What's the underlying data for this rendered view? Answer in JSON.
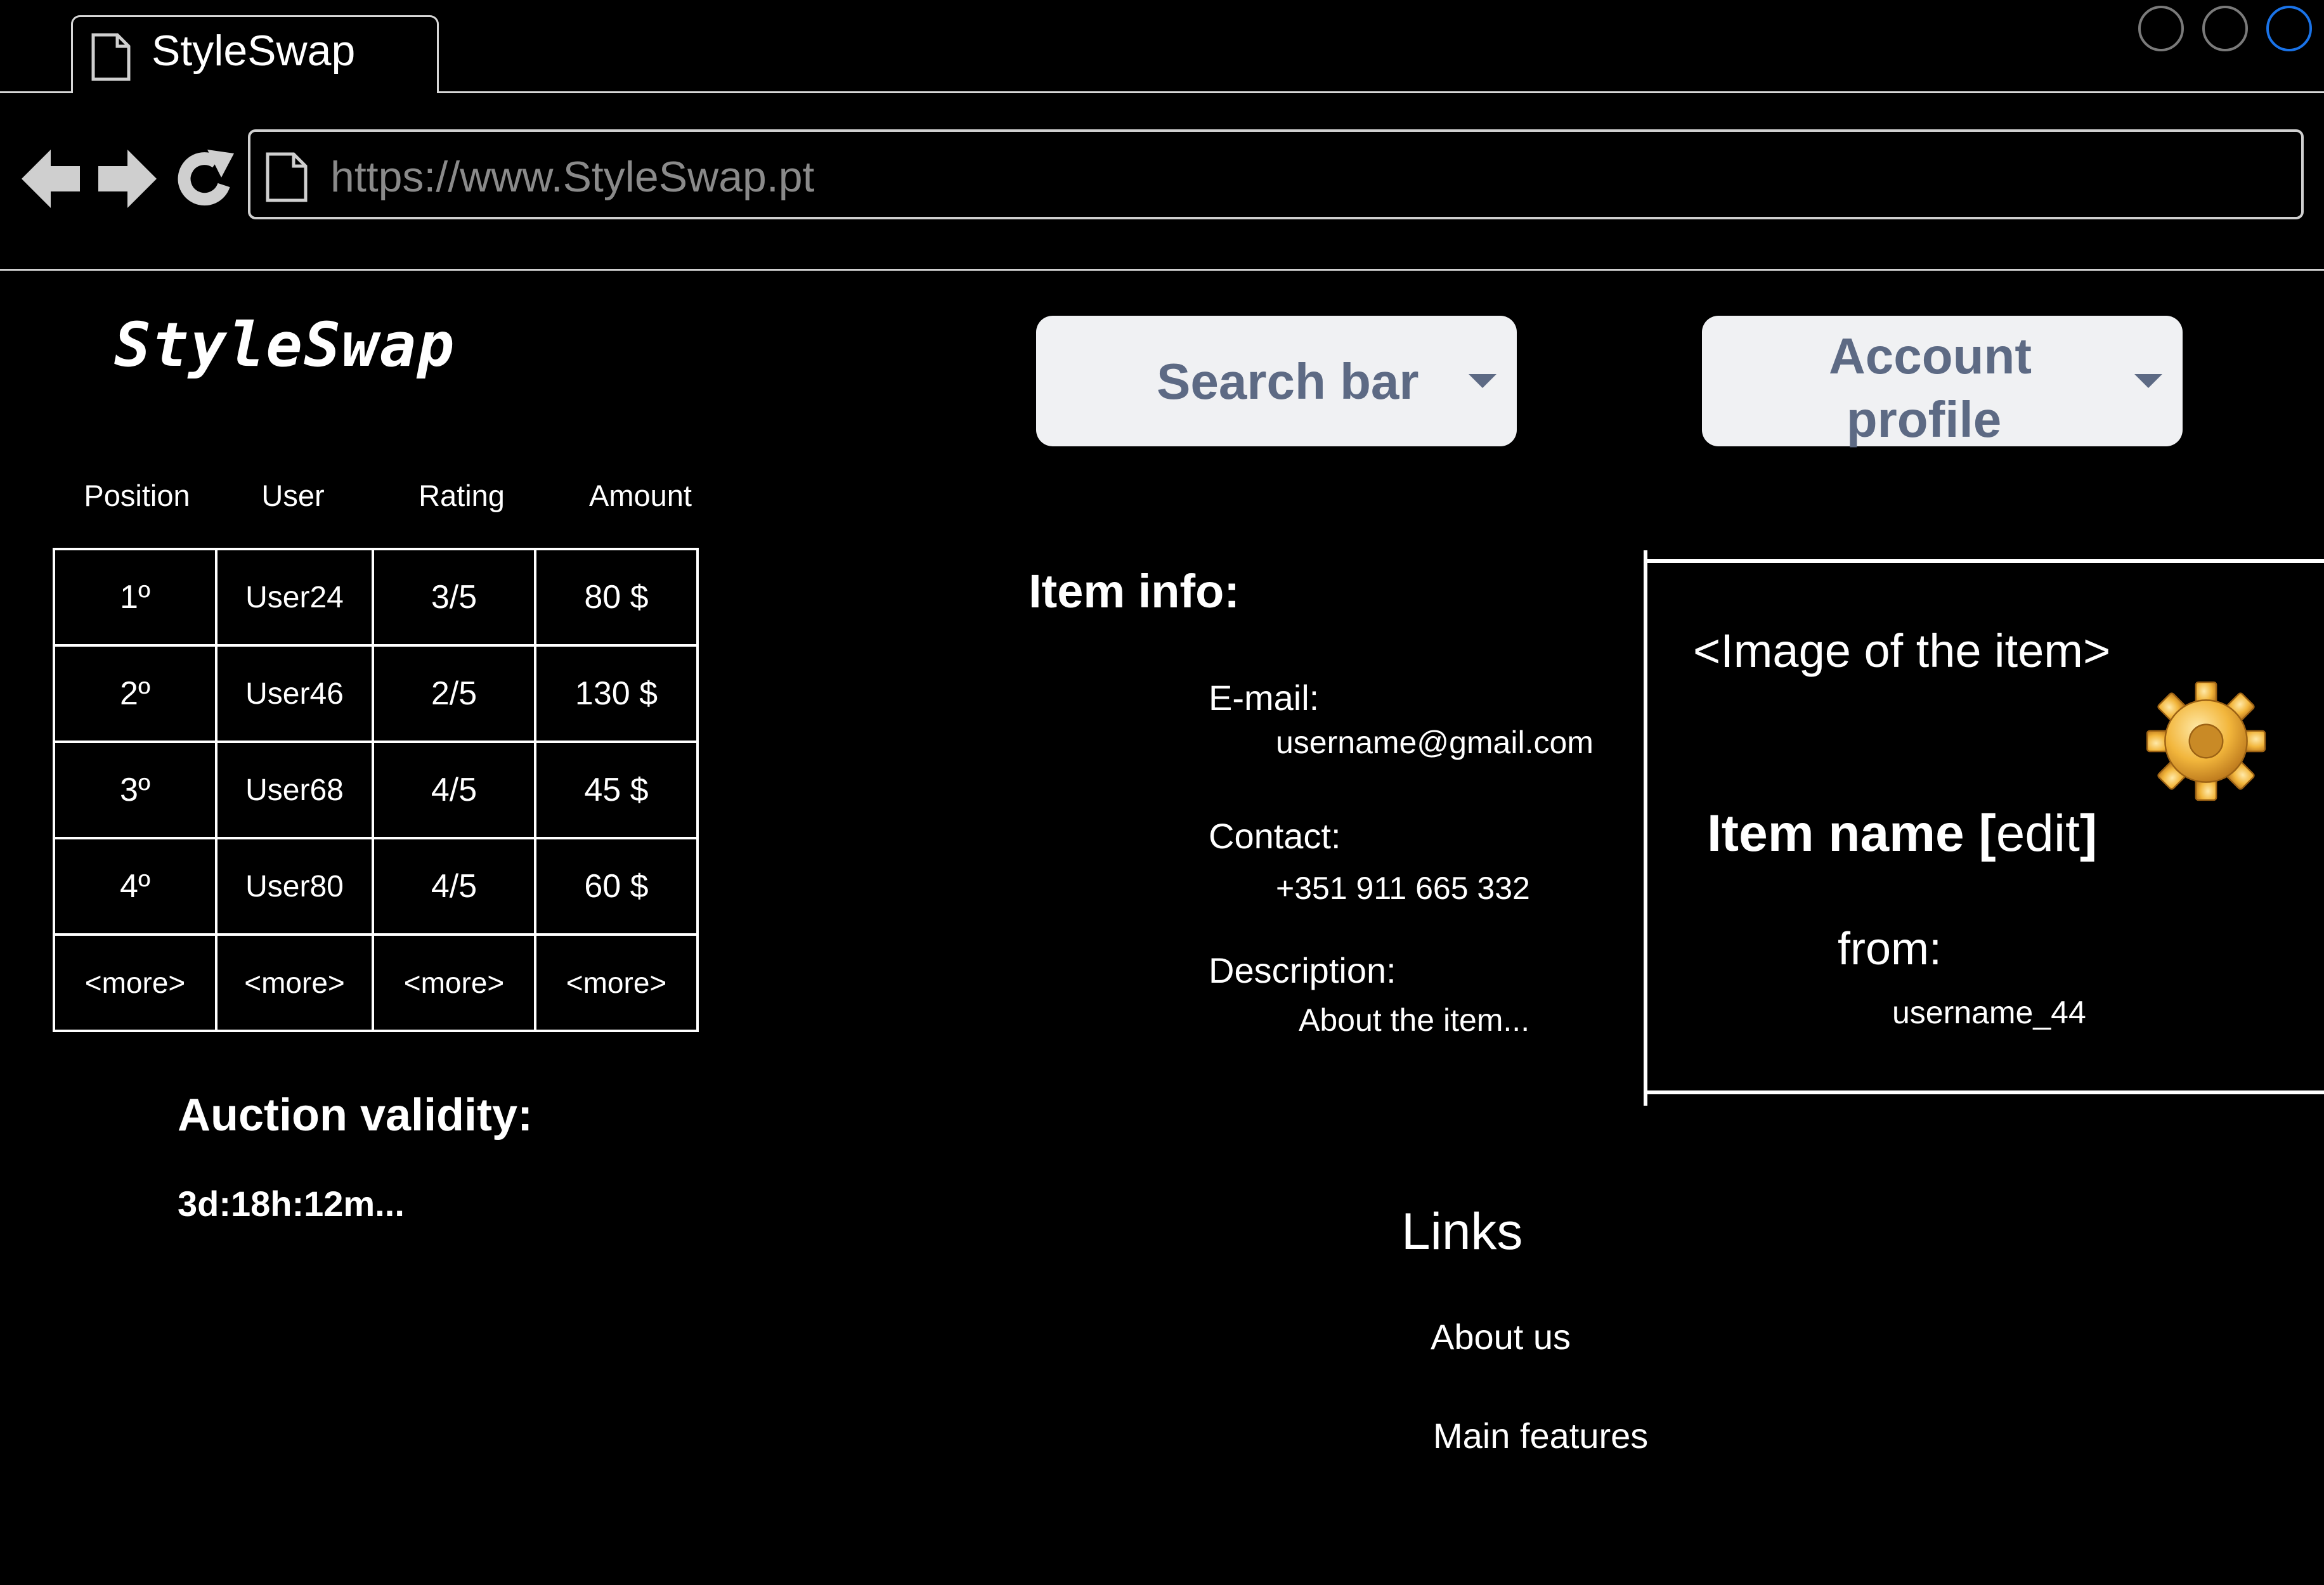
{
  "browser": {
    "tab_title": "StyleSwap",
    "url": "https://www.StyleSwap.pt"
  },
  "header": {
    "logo": "StyleSwap",
    "search_label": "Search bar",
    "account_label": "Account profile"
  },
  "ranking": {
    "columns": [
      "Position",
      "User",
      "Rating",
      "Amount"
    ],
    "rows": [
      [
        "1º",
        "User24",
        "3/5",
        "80 $"
      ],
      [
        "2º",
        "User46",
        "2/5",
        "130 $"
      ],
      [
        "3º",
        "User68",
        "4/5",
        "45 $"
      ],
      [
        "4º",
        "User80",
        "4/5",
        "60 $"
      ],
      [
        "<more>",
        "<more>",
        "<more>",
        "<more>"
      ]
    ]
  },
  "auction": {
    "title": "Auction validity:",
    "time": "3d:18h:12m..."
  },
  "item_info": {
    "title": "Item info:",
    "email_label": "E-mail:",
    "email": "username@gmail.com",
    "contact_label": "Contact:",
    "contact": "+351 911 665 332",
    "description_label": "Description:",
    "description": "About the item..."
  },
  "item_card": {
    "image_placeholder": "<Image of the item>",
    "name": "Item name [",
    "edit": "edit",
    "name_close": "]",
    "from_label": "from:",
    "from_user": "username_44",
    "gear_icon": "gear-icon"
  },
  "links": {
    "title": "Links",
    "items": [
      "About us",
      "Main features"
    ]
  },
  "colors": {
    "background": "#000000",
    "pill_bg": "#f0f1f3",
    "pill_text": "#5d6a84",
    "active_window_button": "#1a73e8"
  }
}
